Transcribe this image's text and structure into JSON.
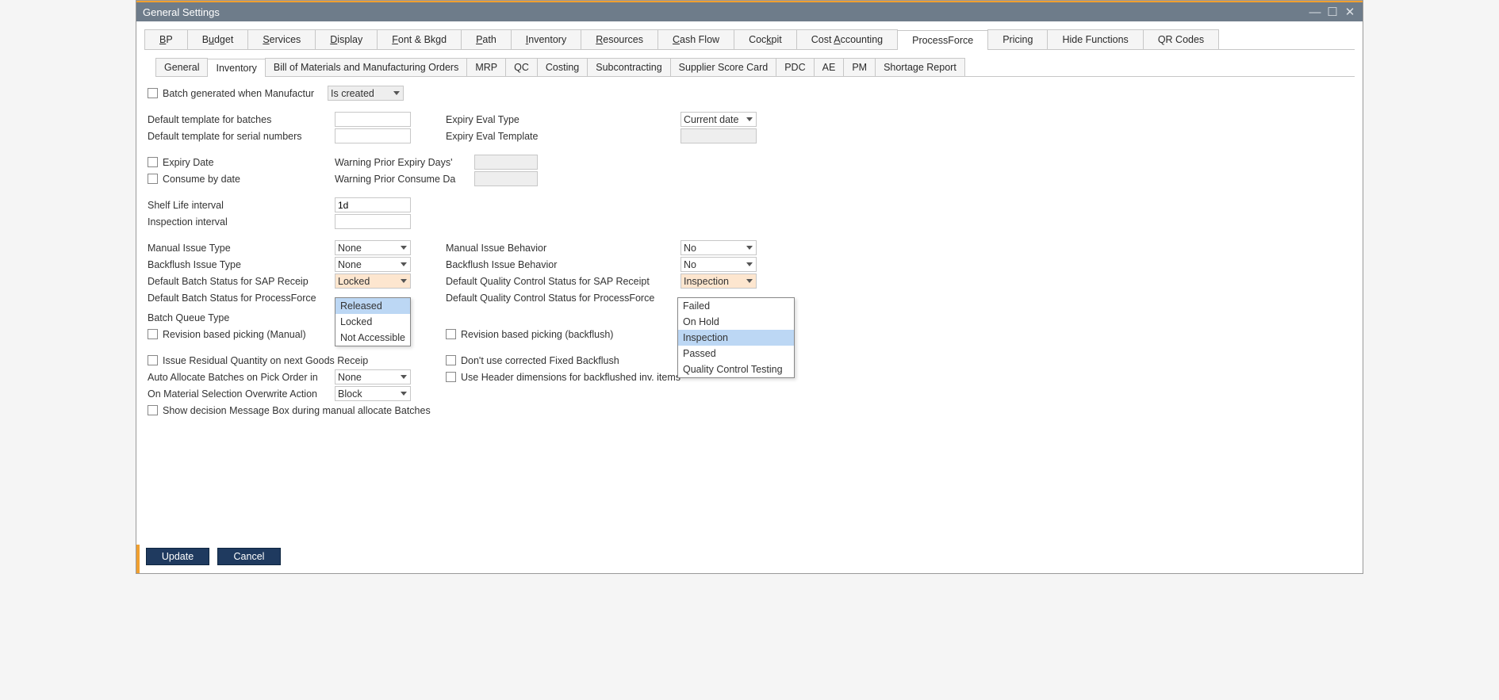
{
  "window": {
    "title": "General Settings"
  },
  "top_tabs": {
    "bp": "BP",
    "budget": "Budget",
    "services": "Services",
    "display": "Display",
    "font": "Font & Bkgd",
    "path": "Path",
    "inventory": "Inventory",
    "resources": "Resources",
    "cashflow": "Cash Flow",
    "cockpit": "Cockpit",
    "costacct": "Cost Accounting",
    "processforce": "ProcessForce",
    "pricing": "Pricing",
    "hidefn": "Hide Functions",
    "qr": "QR Codes"
  },
  "sub_tabs": {
    "general": "General",
    "inventory": "Inventory",
    "bom": "Bill of Materials and Manufacturing Orders",
    "mrp": "MRP",
    "qc": "QC",
    "costing": "Costing",
    "subcon": "Subcontracting",
    "scorecard": "Supplier Score Card",
    "pdc": "PDC",
    "ae": "AE",
    "pm": "PM",
    "shortage": "Shortage Report"
  },
  "fields": {
    "batch_gen_label": "Batch generated when Manufactur",
    "batch_gen_sel": "Is created",
    "def_tpl_batches": "Default template for batches",
    "def_tpl_serial": "Default template for serial numbers",
    "expiry_eval_type": "Expiry Eval Type",
    "expiry_eval_type_val": "Current date",
    "expiry_eval_tpl": "Expiry Eval Template",
    "expiry_date": "Expiry Date",
    "consume_date": "Consume by date",
    "warn_expiry": "Warning Prior Expiry Days'",
    "warn_consume": "Warning Prior Consume Da",
    "shelf_life": "Shelf Life interval",
    "shelf_life_val": "1d",
    "inspection_int": "Inspection interval",
    "manual_issue_type": "Manual Issue Type",
    "manual_issue_type_val": "None",
    "backflush_issue_type": "Backflush Issue Type",
    "backflush_issue_type_val": "None",
    "def_batch_sap": "Default Batch Status for SAP Receip",
    "def_batch_sap_val": "Locked",
    "def_batch_pf": "Default Batch Status for ProcessForce",
    "batch_queue_type": "Batch Queue Type",
    "rev_picking_manual": "Revision based picking (Manual)",
    "manual_issue_beh": "Manual Issue Behavior",
    "manual_issue_beh_val": "No",
    "backflush_issue_beh": "Backflush Issue Behavior",
    "backflush_issue_beh_val": "No",
    "def_qc_sap": "Default Quality Control Status for SAP Receipt",
    "def_qc_sap_val": "Inspection",
    "def_qc_pf": "Default Quality Control Status for ProcessForce",
    "rev_picking_backflush": "Revision based picking (backflush)",
    "issue_residual": "Issue Residual Quantity on next Goods Receip",
    "dont_use_corrected": "Don't use corrected Fixed Backflush",
    "use_header_dims": "Use Header dimensions for backflushed inv. items",
    "auto_alloc": "Auto Allocate Batches on Pick Order in",
    "auto_alloc_val": "None",
    "mat_sel_overwrite": "On Material Selection Overwrite Action",
    "mat_sel_overwrite_val": "Block",
    "show_decision": "Show decision Message Box during manual allocate Batches"
  },
  "batch_status_options": {
    "released": "Released",
    "locked": "Locked",
    "notacc": "Not Accessible"
  },
  "qc_status_options": {
    "failed": "Failed",
    "onhold": "On Hold",
    "inspection": "Inspection",
    "passed": "Passed",
    "qctest": "Quality Control Testing"
  },
  "buttons": {
    "update": "Update",
    "cancel": "Cancel"
  }
}
